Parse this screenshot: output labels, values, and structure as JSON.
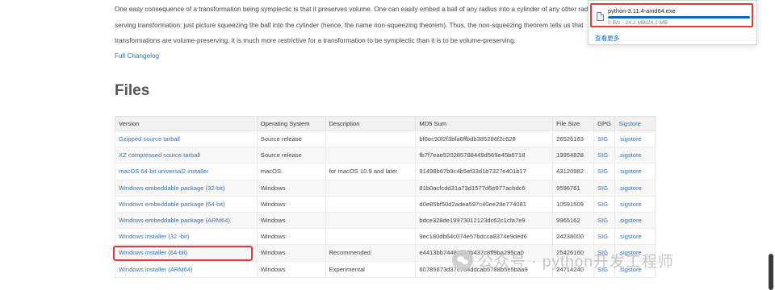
{
  "intro": {
    "lines": [
      "One easy consequence of a transformation being symplectic is that it preserves volume. One can easily embed a ball of any radius into a cylinder of any other radi",
      "serving transformation: just picture squeezing the ball into the cylinder (hence, the name non-squeezing theorem). Thus, the non-squeezing theorem tells us that",
      "transformations are volume-preserving, it is much more restrictive for a transformation to be symplectic than it is to be volume-preserving."
    ]
  },
  "changelog_link": "Full Changelog",
  "files_heading": "Files",
  "table": {
    "headers": {
      "version": "Version",
      "os": "Operating System",
      "description": "Description",
      "md5": "MD5 Sum",
      "size": "File Size",
      "gpg": "GPG",
      "sigstore": "Sigstore"
    },
    "rows": [
      {
        "version": "Gzipped source tarball",
        "os": "Source release",
        "description": "",
        "md5": "bf6ec50f2f3bfa6ffbdb385286f2c628",
        "size": "26526163",
        "gpg": "SIG",
        "sigstore": ".sigstore"
      },
      {
        "version": "XZ compressed source tarball",
        "os": "Source release",
        "description": "",
        "md5": "fb7f7eae520285788449d569e45b6718",
        "size": "19954828",
        "gpg": "SIG",
        "sigstore": ".sigstore"
      },
      {
        "version": "macOS 64-bit universal2 installer",
        "os": "macOS",
        "description": "for macOS 10.9 and later",
        "md5": "91498b67b9c4b5ef33d1b7327e401b17",
        "size": "43120982",
        "gpg": "SIG",
        "sigstore": ".sigstore"
      },
      {
        "version": "Windows embeddable package (32-bit)",
        "os": "Windows",
        "description": "",
        "md5": "81b0acfcdd31a73d1577d6e977acbdc6",
        "size": "9596761",
        "gpg": "SIG",
        "sigstore": ".sigstore"
      },
      {
        "version": "Windows embeddable package (64-bit)",
        "os": "Windows",
        "description": "",
        "md5": "d0e85bf50d2adea597c40ee28e774081",
        "size": "10591509",
        "gpg": "SIG",
        "sigstore": ".sigstore"
      },
      {
        "version": "Windows embeddable package (ARM64)",
        "os": "Windows",
        "description": "",
        "md5": "bdce328de19973012123dc62c1cfa7e9",
        "size": "9965162",
        "gpg": "SIG",
        "sigstore": ".sigstore"
      },
      {
        "version": "Windows installer (32 -bit)",
        "os": "Windows",
        "description": "",
        "md5": "9ec180db64c074e57bdcca8374e9ded6",
        "size": "24238000",
        "gpg": "SIG",
        "sigstore": ".sigstore"
      },
      {
        "version": "Windows installer (64-bit)",
        "os": "Windows",
        "description": "Recommended",
        "md5": "e4413bb7448c213b437c8ff9ba295ca0",
        "size": "25426160",
        "gpg": "SIG",
        "sigstore": ".sigstore"
      },
      {
        "version": "Windows installer (ARM64)",
        "os": "Windows",
        "description": "Experimental",
        "md5": "60785673d37c754ddcab5788b5e5baa9",
        "size": "24714240",
        "gpg": "SIG",
        "sigstore": ".sigstore"
      }
    ]
  },
  "download_panel": {
    "filename": "python-3.11.4-amd64.exe",
    "status": "0 B/s - 24.2 MB/24.2 MB",
    "progress_percent": 100,
    "more_link": "查看更多"
  },
  "watermark": {
    "text": "公众号 · python开发工程师"
  },
  "colors": {
    "link": "#3a70a8",
    "highlight": "#e03a3a",
    "progress": "#0b63d6"
  }
}
